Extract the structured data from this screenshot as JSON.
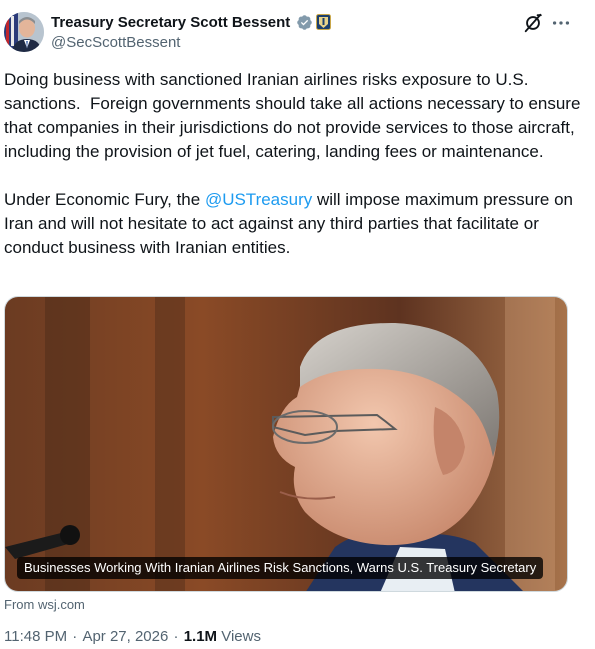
{
  "author": {
    "name": "Treasury Secretary Scott Bessent",
    "handle": "@SecScottBessent"
  },
  "icons": {
    "verified": "verified-badge-icon",
    "affiliate": "treasury-seal-badge-icon",
    "grok": "grok-icon",
    "more": "more-options-icon"
  },
  "tweet": {
    "paragraph1": "Doing business with sanctioned Iranian airlines risks exposure to U.S. sanctions.  Foreign governments should take all actions necessary to ensure that companies in their jurisdictions do not provide services to those aircraft, including the provision of jet fuel, catering, landing fees or maintenance.",
    "paragraph2_before": "Under Economic Fury, the ",
    "mention": "@USTreasury",
    "paragraph2_after": " will impose maximum pressure on Iran and will not hesitate to act against any third parties that facilitate or conduct business with Iranian entities."
  },
  "link_card": {
    "caption": "Businesses Working With Iranian Airlines Risk Sanctions, Warns U.S. Treasury Secretary",
    "source": "From wsj.com"
  },
  "meta": {
    "time": "11:48 PM",
    "separator": " · ",
    "date": "Apr 27, 2026",
    "views_count": "1.1M",
    "views_label": " Views"
  },
  "colors": {
    "link": "#1d9bf0",
    "secondary_text": "#536471",
    "primary_text": "#0f1419",
    "verified_badge": "#829aab"
  }
}
